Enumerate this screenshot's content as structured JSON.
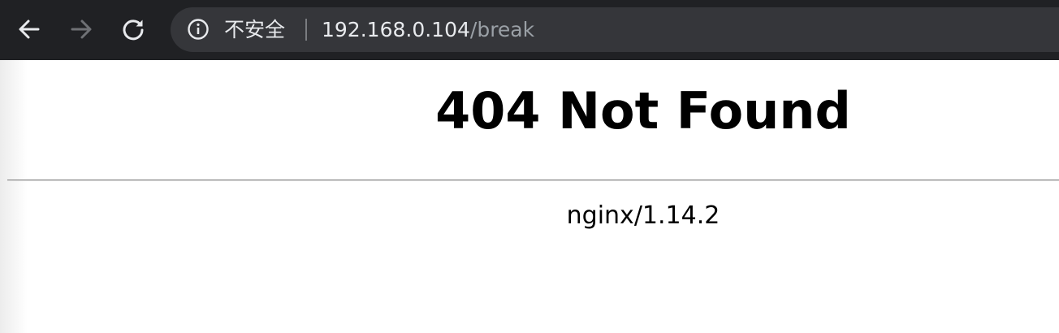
{
  "browser": {
    "back_icon": "arrow-left-icon",
    "forward_icon": "arrow-right-icon",
    "reload_icon": "reload-icon",
    "info_icon": "info-icon",
    "security_label": "不安全",
    "url_host": "192.168.0.104",
    "url_path": "/break",
    "colors": {
      "toolbar": "#202124",
      "omnibox": "#35363a",
      "text": "#e8eaed",
      "muted": "#9aa0a6"
    }
  },
  "page": {
    "heading": "404 Not Found",
    "signature": "nginx/1.14.2"
  }
}
